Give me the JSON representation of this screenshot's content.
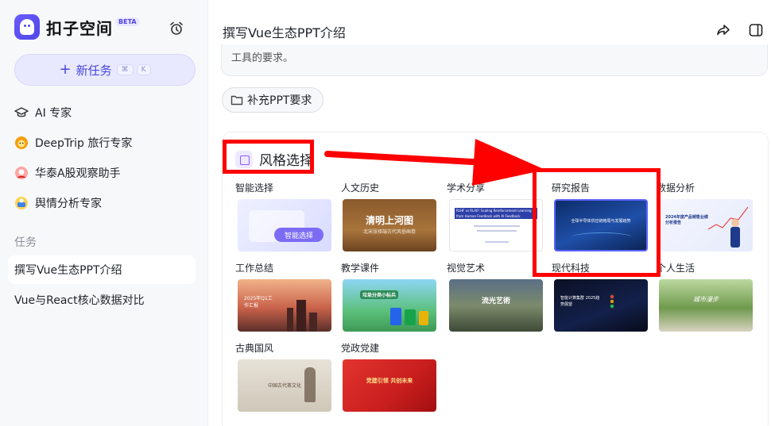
{
  "sidebar": {
    "brand": "扣子空间",
    "beta": "BETA",
    "new_task": {
      "label": "新任务",
      "shortcut_1": "⌘",
      "shortcut_2": "K"
    },
    "experts": [
      {
        "label": "AI 专家",
        "icon": "graduation-cap-icon"
      },
      {
        "label": "DeepTrip 旅行专家",
        "icon": "travel-avatar-icon"
      },
      {
        "label": "华泰A股观察助手",
        "icon": "stock-avatar-icon"
      },
      {
        "label": "舆情分析专家",
        "icon": "sentiment-avatar-icon"
      }
    ],
    "tasks_label": "任务",
    "tasks": [
      {
        "label": "撰写Vue生态PPT介绍",
        "active": true
      },
      {
        "label": "Vue与React核心数据对比",
        "active": false
      }
    ]
  },
  "header": {
    "title": "撰写Vue生态PPT介绍"
  },
  "chat": {
    "message_tail": "工具的要求。",
    "supplement_button": "补充PPT要求"
  },
  "style_selection": {
    "title": "风格选择",
    "tiles": [
      {
        "label": "智能选择",
        "thumb_text": "智能选择"
      },
      {
        "label": "人文历史",
        "thumb_text": "清明上河图",
        "thumb_sub": "北宋张择端古代风俗画卷"
      },
      {
        "label": "学术分享",
        "thumb_text": "RLHF vs RLAIF: Scaling Reinforcement Learning from Human Feedback with AI Feedback"
      },
      {
        "label": "研究报告",
        "thumb_text": "全球半导体供应链格局与发展趋势"
      },
      {
        "label": "数据分析",
        "thumb_text": "2024年度产品销售业绩分析报告"
      },
      {
        "label": "工作总结",
        "thumb_text": "2025年Q1工作汇报"
      },
      {
        "label": "教学课件",
        "thumb_text": "垃圾分类小标兵"
      },
      {
        "label": "视觉艺术",
        "thumb_text": "流光艺術"
      },
      {
        "label": "现代科技",
        "thumb_text": "智能计算集群 2025趋势展望"
      },
      {
        "label": "个人生活",
        "thumb_text": "城市漫步"
      },
      {
        "label": "古典国风",
        "thumb_text": "中国古代茶文化"
      },
      {
        "label": "党政党建",
        "thumb_text": "党建引领 共创未来"
      }
    ]
  },
  "colors": {
    "accent": "#4f46e5",
    "annotation": "#ff0000"
  }
}
